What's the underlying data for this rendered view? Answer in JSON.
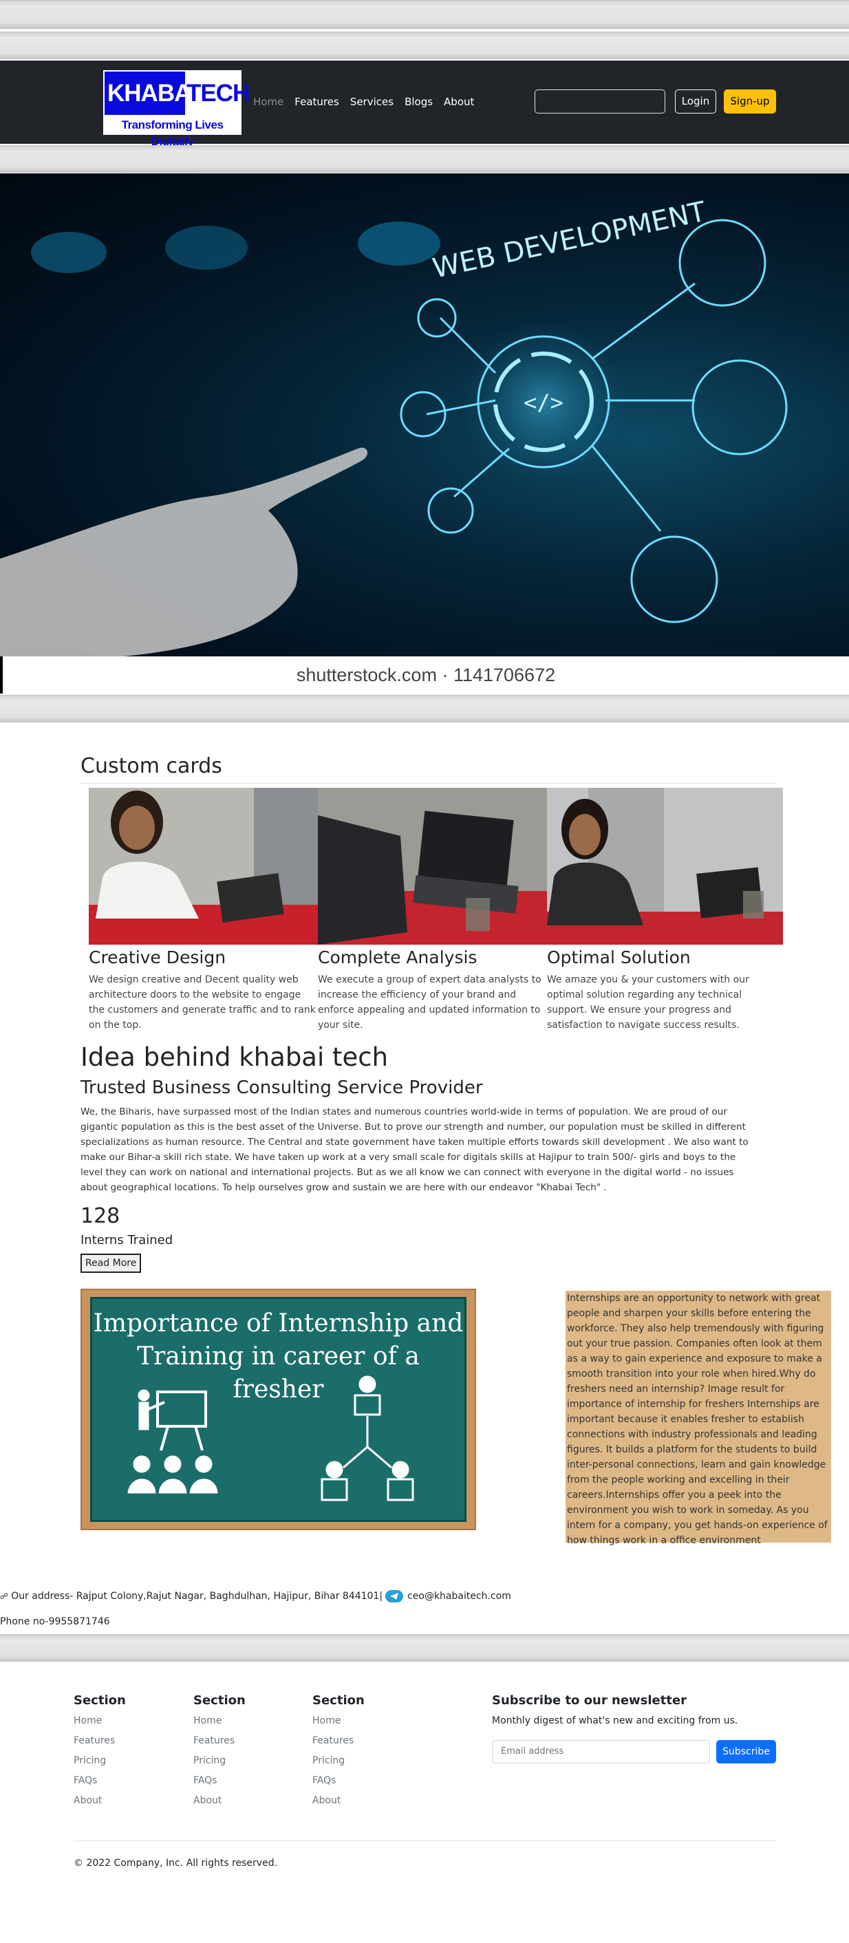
{
  "header": {
    "logo_text_left": "KHABAI",
    "logo_text_right": "TECH",
    "logo_tagline": "Transforming Lives Digitally",
    "nav": [
      "Home",
      "Features",
      "Services",
      "Blogs",
      "About"
    ],
    "search": {
      "value": "",
      "placeholder": ""
    },
    "login_label": "Login",
    "signup_label": "Sign-up"
  },
  "hero": {
    "image_text": "WEB DEVELOPMENT",
    "credit": "shutterstock.com · 1141706672"
  },
  "cards_section": {
    "title": "Custom cards",
    "cards": [
      {
        "title": "Creative Design",
        "text": "We design creative and Decent quality web architecture doors to the website to engage the customers and generate traffic and to rank on the top."
      },
      {
        "title": "Complete Analysis",
        "text": "We execute a group of expert data analysts to increase the efficiency of your brand and enforce appealing and updated information to your site."
      },
      {
        "title": "Optimal Solution",
        "text": "We amaze you & your customers with our optimal solution regarding any technical support. We ensure your progress and satisfaction to navigate success results."
      }
    ]
  },
  "about": {
    "title": "Idea behind khabai tech",
    "subtitle": "Trusted Business Consulting Service Provider",
    "text": "We, the Biharis, have surpassed most of the Indian states and numerous countries world-wide in terms of population. We are proud of our gigantic population as this is the best asset of the Universe. But to prove our strength and number, our population must be skilled in different specializations as human resource. The Central and state government have taken multiple efforts towards skill development . We also want to make our Bihar-a skill rich state. We have taken up work at a very small scale for digitals skills at Hajipur to train 500/- girls and boys to the level they can work on national and international projects. But as we all know we can connect with everyone in the digital world - no issues about geographical locations. To help ourselves grow and sustain we are here with our endeavor \"Khabai Tech\" .",
    "stat_number": "128",
    "stat_label": "Interns Trained",
    "read_more": "Read More"
  },
  "internship": {
    "image_title_line1": "Importance of Internship and",
    "image_title_line2": "Training in career of a fresher",
    "text": "Internships are an opportunity to network with great people and sharpen your skills before entering the workforce. They also help tremendously with figuring out your true passion. Companies often look at them as a way to gain experience and exposure to make a smooth transition into your role when hired.Why do freshers need an internship? Image result for importance of internship for freshers Internships are important because it enables fresher to establish connections with industry professionals and leading figures. It builds a platform for the students to build inter-personal connections, learn and gain knowledge from the people working and excelling in their careers.Internships offer you a peek into the environment you wish to work in someday. As you intern for a company, you get hands-on experience of how things work in a office environment"
  },
  "contact": {
    "address": "Our address- Rajput Colony,Rajut Nagar, Baghdulhan, Hajipur, Bihar 844101",
    "email": "ceo@khabaitech.com",
    "phone": "Phone no-9955871746"
  },
  "footer": {
    "columns": [
      {
        "title": "Section",
        "links": [
          "Home",
          "Features",
          "Pricing",
          "FAQs",
          "About"
        ]
      },
      {
        "title": "Section",
        "links": [
          "Home",
          "Features",
          "Pricing",
          "FAQs",
          "About"
        ]
      },
      {
        "title": "Section",
        "links": [
          "Home",
          "Features",
          "Pricing",
          "FAQs",
          "About"
        ]
      }
    ],
    "newsletter_title": "Subscribe to our newsletter",
    "newsletter_sub": "Monthly digest of what's new and exciting from us.",
    "email_placeholder": "Email address",
    "subscribe_label": "Subscribe",
    "copyright": "© 2022 Company, Inc. All rights reserved."
  },
  "colors": {
    "navbar": "#212529",
    "signup": "#ffc107",
    "logo_blue": "#0909dc",
    "subscribe": "#0d6efd",
    "intern_box": "#deb887",
    "chalkboard": "#1b6d6a"
  }
}
